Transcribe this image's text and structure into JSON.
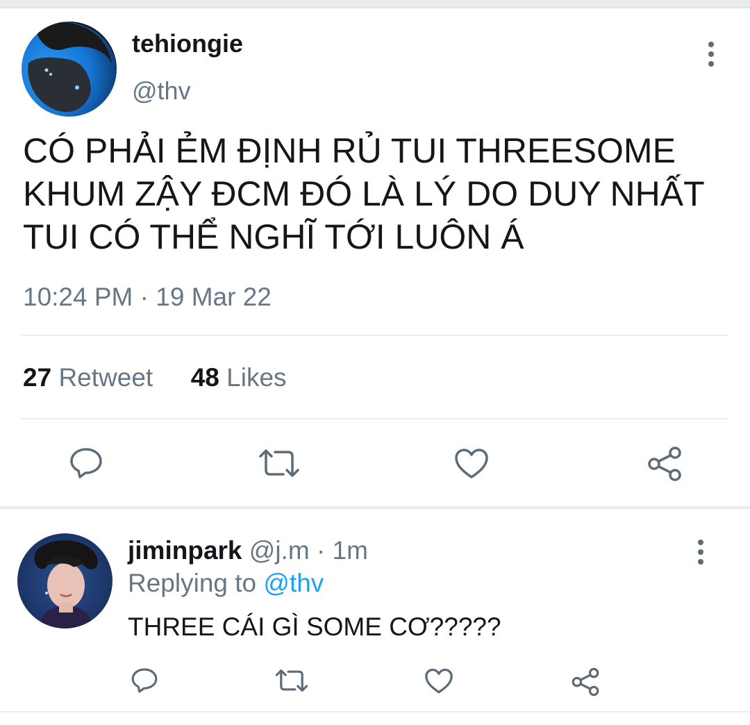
{
  "colors": {
    "text": "#14171a",
    "secondary": "#657786",
    "link": "#1da1f2",
    "divider": "#e6ecf0",
    "icon": "#5b6b78"
  },
  "tweet": {
    "display_name": "tehiongie",
    "handle": "@thv",
    "text": "CÓ PHẢI ẺM ĐỊNH RỦ TUI THREESOME\nKHUM ZẬY ĐCM ĐÓ LÀ LÝ DO DUY NHẤT\nTUI CÓ THỂ NGHĨ TỚI LUÔN Á",
    "time": "10:24 PM",
    "date": "19 Mar 22",
    "meta_separator": "·",
    "retweet_count": "27",
    "retweet_label": "Retweet",
    "like_count": "48",
    "like_label": "Likes",
    "actions": [
      "reply-icon",
      "retweet-icon",
      "like-icon",
      "share-icon"
    ]
  },
  "reply": {
    "display_name": "jiminpark",
    "handle": "@j.m",
    "separator": "·",
    "age": "1m",
    "replying_label": "Replying to",
    "replying_to": "@thv",
    "text": "THREE CÁI GÌ SOME CƠ?????",
    "actions": [
      "reply-icon",
      "retweet-icon",
      "like-icon",
      "share-icon"
    ]
  }
}
